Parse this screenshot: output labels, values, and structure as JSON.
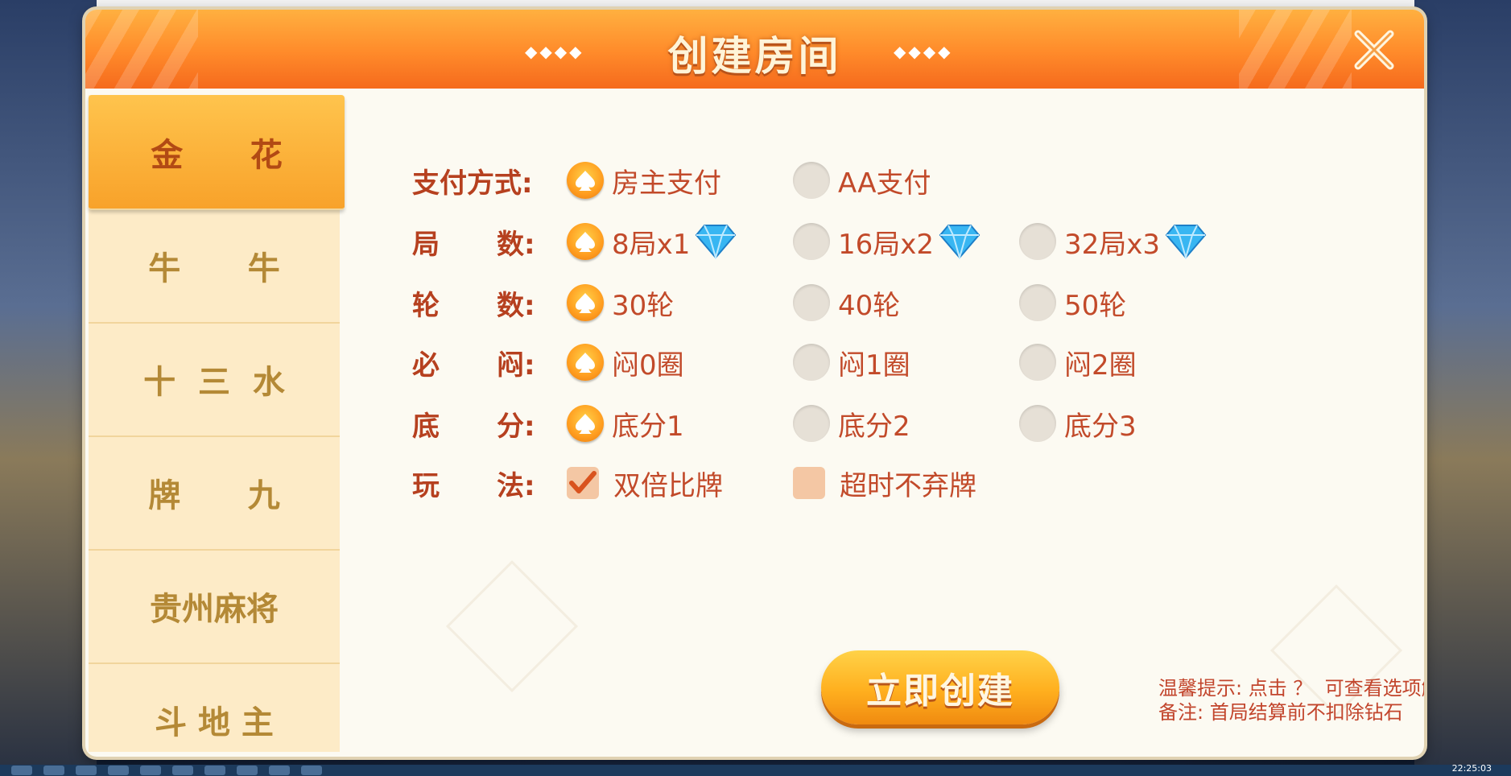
{
  "dialog": {
    "title": "创建房间",
    "deco_left": "◆◆◆◆",
    "deco_right": "◆◆◆◆"
  },
  "sidebar": {
    "tabs": [
      {
        "label": "金      花",
        "active": true
      },
      {
        "label": "牛      牛",
        "active": false
      },
      {
        "label": "十  三  水",
        "active": false
      },
      {
        "label": "牌      九",
        "active": false
      },
      {
        "label": "贵州麻将",
        "active": false
      },
      {
        "label": "斗 地 主",
        "active": false
      }
    ]
  },
  "options": {
    "payment": {
      "label": "支付方式:",
      "choices": [
        "房主支付",
        "AA支付"
      ],
      "selected": 0
    },
    "rounds": {
      "label": "局      数:",
      "choices": [
        "8局x1",
        "16局x2",
        "32局x3"
      ],
      "selected": 0
    },
    "turns": {
      "label": "轮      数:",
      "choices": [
        "30轮",
        "40轮",
        "50轮"
      ],
      "selected": 0
    },
    "blind": {
      "label": "必      闷:",
      "choices": [
        "闷0圈",
        "闷1圈",
        "闷2圈"
      ],
      "selected": 0
    },
    "base": {
      "label": "底      分:",
      "choices": [
        "底分1",
        "底分2",
        "底分3"
      ],
      "selected": 0
    },
    "play": {
      "label": "玩      法:",
      "choices": [
        "双倍比牌",
        "超时不弃牌"
      ],
      "checked": [
        true,
        false
      ]
    }
  },
  "create_button": "立即创建",
  "tip": {
    "line1": "温馨提示: 点击 ？  可查看选项解释",
    "line2": "备注: 首局结算前不扣除钻石"
  },
  "taskbar": {
    "clock": "22:25:03"
  },
  "colors": {
    "accent": "#ff9d1f",
    "label": "#b6401f",
    "text": "#c24a2a"
  }
}
